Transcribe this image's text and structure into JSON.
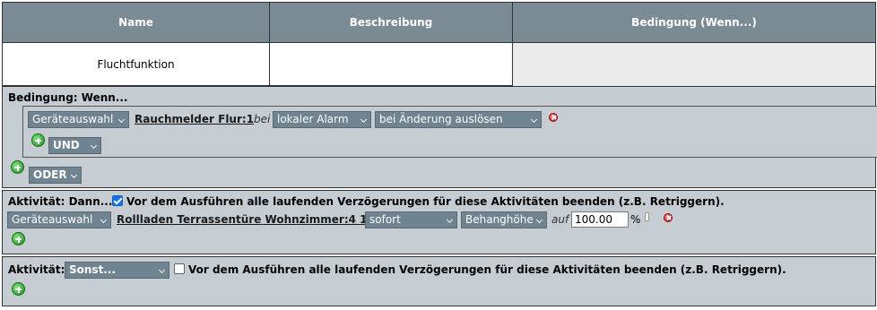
{
  "table": {
    "headers": [
      "Name",
      "Beschreibung",
      "Bedingung (Wenn...)"
    ],
    "row": {
      "name": "Fluchtfunktion",
      "beschreibung": "",
      "bedingung": ""
    }
  },
  "condition_panel": {
    "title": "Bedingung: Wenn...",
    "device_select": "Geräteauswahl",
    "device_link": "Rauchmelder Flur:1",
    "bei_label": "bei",
    "trigger_select": "lokaler Alarm",
    "change_select": "bei Änderung auslösen",
    "und_select": "UND",
    "oder_select": "ODER"
  },
  "activity_then": {
    "title": "Aktivität: Dann...",
    "checkbox_checked": true,
    "checkbox_label": "Vor dem Ausführen alle laufenden Verzögerungen für diese Aktivitäten beenden (z.B. Retriggern).",
    "device_select": "Geräteauswahl",
    "device_link": "Rollladen Terrassentüre Wohnzimmer:4 1",
    "timing_select": "sofort",
    "param_select": "Behanghöhe",
    "auf_label": "auf",
    "value": "100.00",
    "unit": "%"
  },
  "activity_else": {
    "title": "Aktivität:",
    "sonst_select": "Sonst...",
    "checkbox_checked": false,
    "checkbox_label": "Vor dem Ausführen alle laufenden Verzögerungen für diese Aktivitäten beenden (z.B. Retriggern)."
  },
  "colors": {
    "header_bg": "#7a8b96",
    "panel_bg": "#c6cdd2",
    "select_dark": "#6f8390"
  }
}
